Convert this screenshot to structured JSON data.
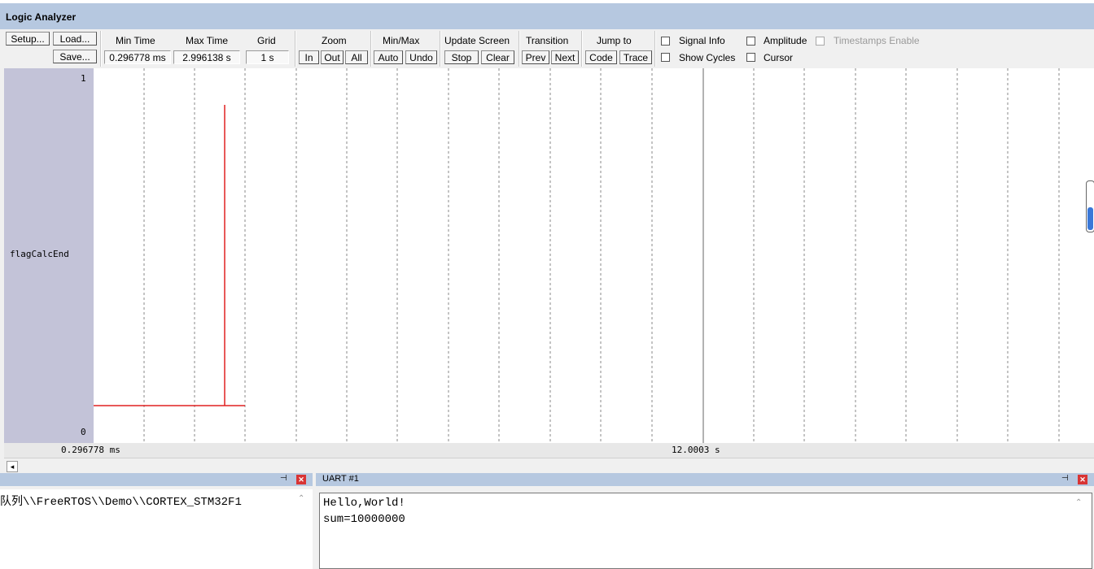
{
  "window": {
    "title": "Logic Analyzer"
  },
  "toolbar": {
    "setup": "Setup...",
    "load": "Load...",
    "save": "Save...",
    "min_time_label": "Min Time",
    "min_time_value": "0.296778 ms",
    "max_time_label": "Max Time",
    "max_time_value": "2.996138 s",
    "grid_label": "Grid",
    "grid_value": "1 s",
    "zoom_label": "Zoom",
    "zoom_in": "In",
    "zoom_out": "Out",
    "zoom_all": "All",
    "minmax_label": "Min/Max",
    "auto": "Auto",
    "undo": "Undo",
    "update_label": "Update Screen",
    "stop": "Stop",
    "clear": "Clear",
    "transition_label": "Transition",
    "prev": "Prev",
    "next": "Next",
    "jump_label": "Jump to",
    "code": "Code",
    "trace": "Trace",
    "signal_info": "Signal Info",
    "show_cycles": "Show Cycles",
    "amplitude": "Amplitude",
    "cursor": "Cursor",
    "timestamps": "Timestamps Enable"
  },
  "signal": {
    "name": "flagCalcEnd",
    "y_max_label": "1",
    "y_min_label": "0"
  },
  "timebar": {
    "left": "0.296778 ms",
    "cursor": "12.0003 s"
  },
  "bottom": {
    "left_path": "队列\\\\FreeRTOS\\\\Demo\\\\CORTEX_STM32F1",
    "uart_title": "UART #1",
    "uart_lines": [
      "Hello,World!",
      "sum=10000000"
    ]
  },
  "colors": {
    "signal": "#e02020",
    "title_bg": "#b6c8e0",
    "name_panel": "#c3c3d8"
  }
}
